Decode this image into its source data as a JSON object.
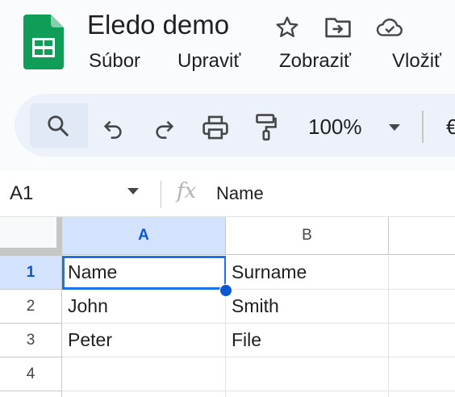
{
  "header": {
    "title": "Eledo demo",
    "menu": [
      "Súbor",
      "Upraviť",
      "Zobraziť",
      "Vložiť"
    ]
  },
  "toolbar": {
    "zoom": "100%",
    "currency_partial": "€",
    "icons": [
      "search-icon",
      "undo-icon",
      "redo-icon",
      "print-icon",
      "paint-format-icon",
      "chevron-down-icon"
    ]
  },
  "formula_bar": {
    "name_box": "A1",
    "fx_label": "fx",
    "value": "Name"
  },
  "grid": {
    "columns": [
      "A",
      "B"
    ],
    "rows": [
      {
        "number": "1",
        "cells": [
          "Name",
          "Surname"
        ]
      },
      {
        "number": "2",
        "cells": [
          "John",
          "Smith"
        ]
      },
      {
        "number": "3",
        "cells": [
          "Peter",
          "File"
        ]
      },
      {
        "number": "4",
        "cells": [
          "",
          ""
        ]
      }
    ],
    "active_cell": "A1"
  },
  "colors": {
    "brand_green": "#0f9d58",
    "selection_blue": "#1a73e8",
    "header_highlight": "#d3e3fd",
    "toolbar_bg": "#edf2fa"
  }
}
